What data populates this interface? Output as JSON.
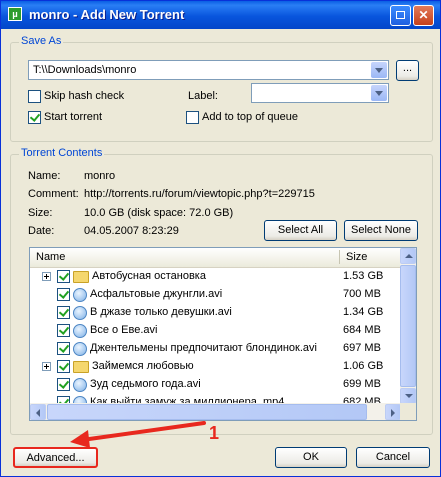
{
  "window": {
    "title": "monro - Add New Torrent",
    "app_icon_text": "μ"
  },
  "save_as": {
    "group_label": "Save As",
    "path": "T:\\\\Downloads\\monro",
    "browse_label": "...",
    "skip_hash_label": "Skip hash check",
    "skip_hash_checked": false,
    "label_label": "Label:",
    "label_value": "",
    "start_torrent_label": "Start torrent",
    "start_torrent_checked": true,
    "add_top_label": "Add to top of queue",
    "add_top_checked": false
  },
  "contents": {
    "group_label": "Torrent Contents",
    "name_key": "Name:",
    "name_value": "monro",
    "comment_key": "Comment:",
    "comment_value": "http://torrents.ru/forum/viewtopic.php?t=229715",
    "size_key": "Size:",
    "size_value": "10.0 GB (disk space: 72.0 GB)",
    "date_key": "Date:",
    "date_value": "04.05.2007 8:23:29",
    "select_all_label": "Select All",
    "select_none_label": "Select None",
    "columns": {
      "name": "Name",
      "size": "Size"
    },
    "rows": [
      {
        "name": "Автобусная остановка",
        "size": "1.53 GB",
        "type": "folder",
        "checked": true
      },
      {
        "name": "Асфальтовые джунгли.avi",
        "size": "700 MB",
        "type": "file",
        "checked": true
      },
      {
        "name": "В джазе только девушки.avi",
        "size": "1.34 GB",
        "type": "file",
        "checked": true
      },
      {
        "name": "Все о Еве.avi",
        "size": "684 MB",
        "type": "file",
        "checked": true
      },
      {
        "name": "Джентельмены предпочитают блондинок.avi",
        "size": "697 MB",
        "type": "file",
        "checked": true
      },
      {
        "name": "Займемся любовью",
        "size": "1.06 GB",
        "type": "folder",
        "checked": true
      },
      {
        "name": "Зуд седьмого года.avi",
        "size": "699 MB",
        "type": "file",
        "checked": true
      },
      {
        "name": "Как выйти замуж за миллионера .mp4",
        "size": "682 MB",
        "type": "file",
        "checked": true
      }
    ]
  },
  "footer": {
    "advanced_label": "Advanced...",
    "ok_label": "OK",
    "cancel_label": "Cancel"
  },
  "annotation": {
    "number": "1",
    "color": "#e8281e"
  }
}
